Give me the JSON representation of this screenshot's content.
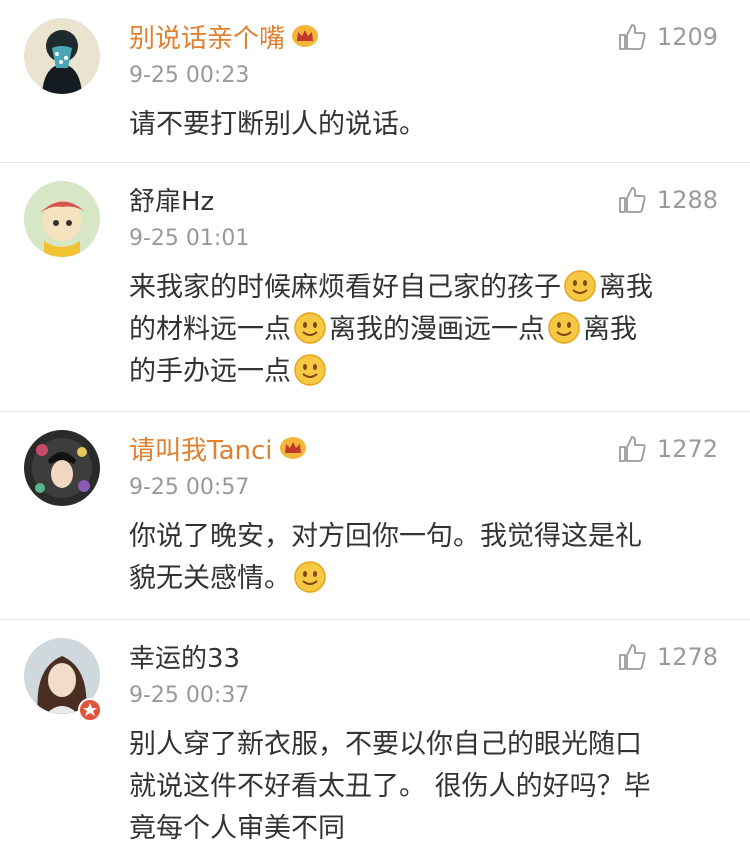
{
  "comments": [
    {
      "username": "别说话亲个嘴",
      "time": "9-25 00:23",
      "likes": "1209",
      "text": [
        "请不要打断别人的说话。"
      ]
    },
    {
      "username": "舒扉Hz",
      "time": "9-25 01:01",
      "likes": "1288",
      "text": [
        "来我家的时候麻烦看好自己家的孩子",
        "离我",
        "的材料远一点",
        "离我的漫画远一点",
        "离我",
        "的手办远一点"
      ]
    },
    {
      "username": "请叫我Tanci",
      "time": "9-25 00:57",
      "likes": "1272",
      "text": [
        "你说了晚安，对方回你一句。我觉得这是礼",
        "貌无关感情。"
      ]
    },
    {
      "username": "幸运的33",
      "time": "9-25 00:37",
      "likes": "1278",
      "text": [
        "别人穿了新衣服，不要以你自己的眼光随口",
        "就说这件不好看太丑了。 很伤人的好吗？毕",
        "竟每个人审美不同"
      ]
    }
  ],
  "icons": {
    "like": "thumbs-up-icon",
    "crown": "crown-icon",
    "smile": "smile-emoji-icon"
  },
  "colors": {
    "member_name": "#e08030",
    "normal_name": "#333333",
    "time": "#999999",
    "like": "#9a9a9a"
  }
}
